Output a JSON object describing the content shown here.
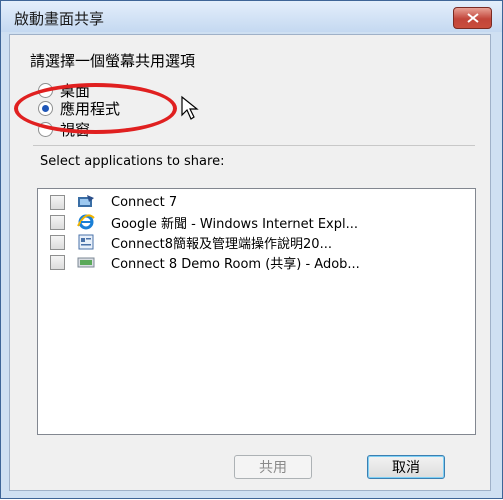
{
  "window": {
    "title": "啟動畫面共享"
  },
  "dialog": {
    "heading": "請選擇一個螢幕共用選項",
    "options": [
      {
        "label": "桌面",
        "selected": false
      },
      {
        "label": "應用程式",
        "selected": true
      },
      {
        "label": "視窗",
        "selected": false
      }
    ],
    "select_label": "Select applications to share:",
    "apps": [
      {
        "label": "Connect 7",
        "icon": "connect-app-icon",
        "checked": false
      },
      {
        "label": "Google 新聞 - Windows Internet Expl...",
        "icon": "internet-explorer-icon",
        "checked": false
      },
      {
        "label": "Connect8簡報及管理端操作說明20...",
        "icon": "document-app-icon",
        "checked": false
      },
      {
        "label": "Connect 8 Demo Room (共享) - Adob...",
        "icon": "adobe-connect-icon",
        "checked": false
      }
    ],
    "buttons": {
      "share": "共用",
      "cancel": "取消"
    }
  },
  "colors": {
    "annotation": "#e02020",
    "accent": "#1e56b8",
    "close": "#c2453a"
  }
}
